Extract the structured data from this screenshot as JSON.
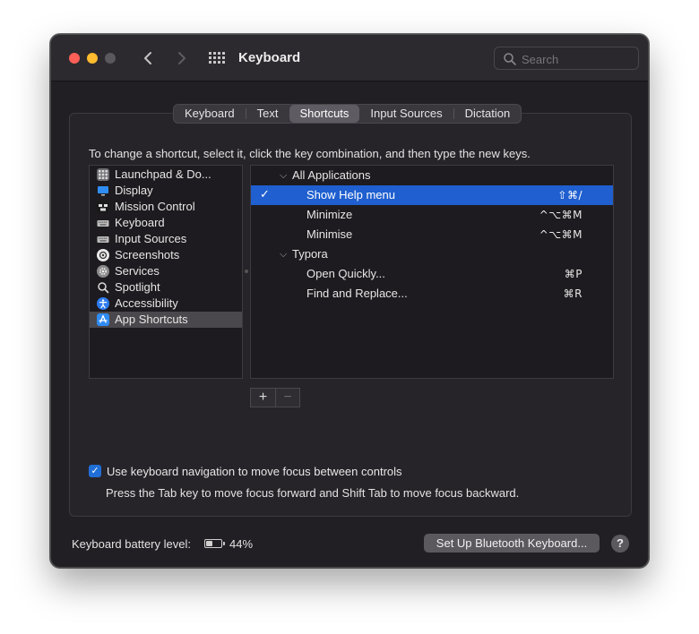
{
  "window": {
    "title": "Keyboard"
  },
  "search": {
    "placeholder": "Search"
  },
  "tabs": [
    {
      "label": "Keyboard"
    },
    {
      "label": "Text"
    },
    {
      "label": "Shortcuts",
      "active": true
    },
    {
      "label": "Input Sources"
    },
    {
      "label": "Dictation"
    }
  ],
  "instructions": "To change a shortcut, select it, click the key combination, and then type the new keys.",
  "categories": [
    {
      "label": "Launchpad & Do...",
      "icon": "launchpad-icon",
      "color": "#6e6e73"
    },
    {
      "label": "Display",
      "icon": "display-icon",
      "color": "#2f8cf5"
    },
    {
      "label": "Mission Control",
      "icon": "mission-control-icon",
      "color": "#1a1a1a"
    },
    {
      "label": "Keyboard",
      "icon": "keyboard-icon",
      "color": "#bdbdbd"
    },
    {
      "label": "Input Sources",
      "icon": "input-sources-icon",
      "color": "#bdbdbd"
    },
    {
      "label": "Screenshots",
      "icon": "screenshots-icon",
      "color": "#e8e8e8"
    },
    {
      "label": "Services",
      "icon": "gear-icon",
      "color": "#9a9a9a"
    },
    {
      "label": "Spotlight",
      "icon": "spotlight-icon",
      "color": "#cfcfcf"
    },
    {
      "label": "Accessibility",
      "icon": "accessibility-icon",
      "color": "#2f7cf0"
    },
    {
      "label": "App Shortcuts",
      "icon": "app-store-icon",
      "color": "#2f8cf5",
      "selected": true
    }
  ],
  "shortcuts": [
    {
      "type": "group",
      "label": "All Applications"
    },
    {
      "type": "item",
      "label": "Show Help menu",
      "key": "⇧⌘/",
      "checked": true,
      "selected": true
    },
    {
      "type": "item",
      "label": "Minimize",
      "key": "^⌥⌘M"
    },
    {
      "type": "item",
      "label": "Minimise",
      "key": "^⌥⌘M"
    },
    {
      "type": "group",
      "label": "Typora"
    },
    {
      "type": "item",
      "label": "Open Quickly...",
      "key": "⌘P"
    },
    {
      "type": "item",
      "label": "Find and Replace...",
      "key": "⌘R"
    }
  ],
  "buttons": {
    "add": "+",
    "remove": "−",
    "bluetooth": "Set Up Bluetooth Keyboard...",
    "help": "?"
  },
  "keyboard_navigation": {
    "checked": true,
    "label": "Use keyboard navigation to move focus between controls",
    "help": "Press the Tab key to move focus forward and Shift Tab to move focus backward."
  },
  "battery": {
    "label": "Keyboard battery level:",
    "percent_text": "44%",
    "level": 0.44
  },
  "colors": {
    "accent": "#1f5fcf",
    "background": "#221f24"
  }
}
